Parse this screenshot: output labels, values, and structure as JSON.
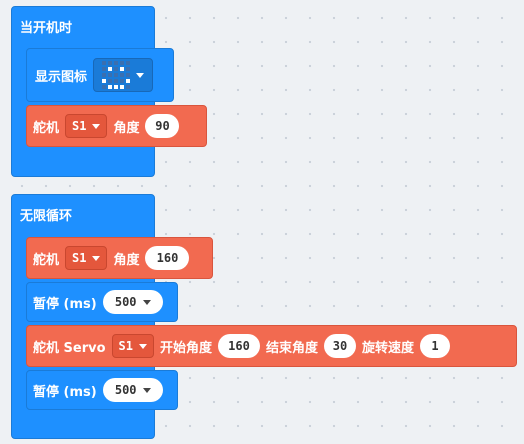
{
  "on_start": {
    "label": "当开机时",
    "show_icon": {
      "label": "显示图标",
      "icon_pixels": [
        [
          0,
          0,
          0,
          0,
          0
        ],
        [
          0,
          1,
          0,
          1,
          0
        ],
        [
          0,
          0,
          0,
          0,
          0
        ],
        [
          1,
          0,
          0,
          0,
          1
        ],
        [
          0,
          1,
          1,
          1,
          0
        ]
      ]
    },
    "servo": {
      "label": "舵机",
      "port": "S1",
      "angle_label": "角度",
      "angle": "90"
    }
  },
  "forever": {
    "label": "无限循环",
    "servo": {
      "label": "舵机",
      "port": "S1",
      "angle_label": "角度",
      "angle": "160"
    },
    "pause1": {
      "label": "暂停 (ms)",
      "value": "500"
    },
    "servo_sweep": {
      "label": "舵机 Servo",
      "port": "S1",
      "start_label": "开始角度",
      "start": "160",
      "end_label": "结束角度",
      "end": "30",
      "speed_label": "旋转速度",
      "speed": "1"
    },
    "pause2": {
      "label": "暂停 (ms)",
      "value": "500"
    }
  },
  "colors": {
    "event_blue": "#1e90ff",
    "servo_red": "#f26a50"
  }
}
